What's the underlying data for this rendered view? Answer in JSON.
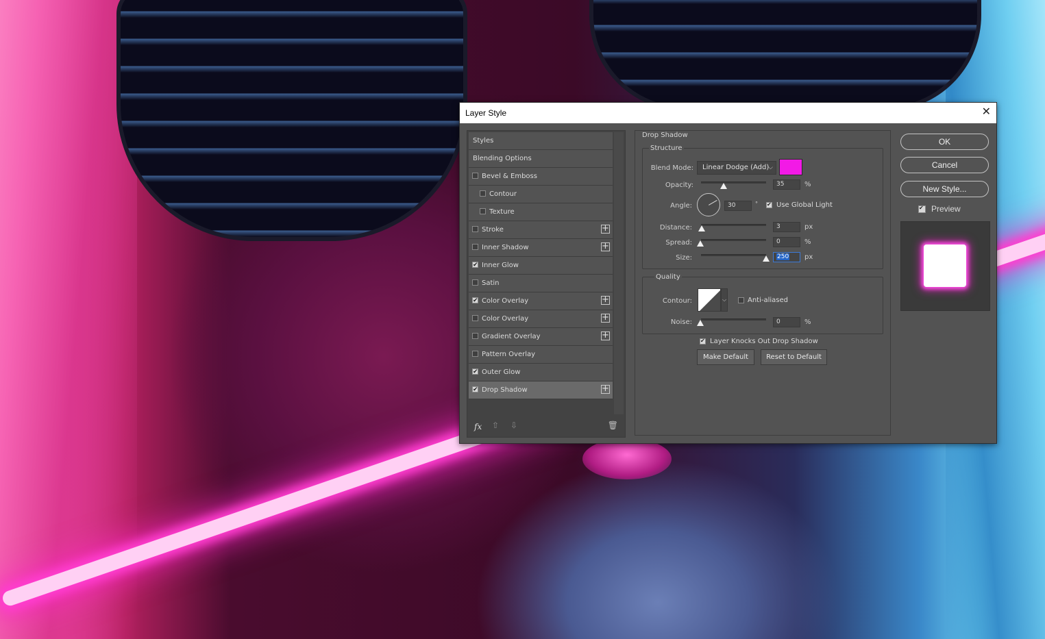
{
  "dialog": {
    "title": "Layer Style",
    "close_glyph": "✕"
  },
  "styles_list": {
    "header": "Styles",
    "blending_options": "Blending Options",
    "items": [
      {
        "label": "Bevel & Emboss",
        "checked": false,
        "has_plus": false,
        "indent": false
      },
      {
        "label": "Contour",
        "checked": false,
        "has_plus": false,
        "indent": true
      },
      {
        "label": "Texture",
        "checked": false,
        "has_plus": false,
        "indent": true
      },
      {
        "label": "Stroke",
        "checked": false,
        "has_plus": true,
        "indent": false
      },
      {
        "label": "Inner Shadow",
        "checked": false,
        "has_plus": true,
        "indent": false
      },
      {
        "label": "Inner Glow",
        "checked": true,
        "has_plus": false,
        "indent": false
      },
      {
        "label": "Satin",
        "checked": false,
        "has_plus": false,
        "indent": false
      },
      {
        "label": "Color Overlay",
        "checked": true,
        "has_plus": true,
        "indent": false
      },
      {
        "label": "Color Overlay",
        "checked": false,
        "has_plus": true,
        "indent": false
      },
      {
        "label": "Gradient Overlay",
        "checked": false,
        "has_plus": true,
        "indent": false
      },
      {
        "label": "Pattern Overlay",
        "checked": false,
        "has_plus": false,
        "indent": false
      },
      {
        "label": "Outer Glow",
        "checked": true,
        "has_plus": false,
        "indent": false
      },
      {
        "label": "Drop Shadow",
        "checked": true,
        "has_plus": true,
        "indent": false,
        "selected": true
      }
    ],
    "fx_label": "fx"
  },
  "drop_shadow": {
    "title": "Drop Shadow",
    "structure_title": "Structure",
    "blend_mode_label": "Blend Mode:",
    "blend_mode_value": "Linear Dodge (Add)",
    "shadow_color": "#f21ae6",
    "opacity_label": "Opacity:",
    "opacity_value": "35",
    "opacity_fraction": 0.35,
    "percent_unit": "%",
    "angle_label": "Angle:",
    "angle_value": "30",
    "degree_unit": "°",
    "use_global_light_label": "Use Global Light",
    "use_global_light": true,
    "distance_label": "Distance:",
    "distance_value": "3",
    "px_unit": "px",
    "spread_label": "Spread:",
    "spread_value": "0",
    "size_label": "Size:",
    "size_value": "250",
    "quality_title": "Quality",
    "contour_label": "Contour:",
    "anti_aliased_label": "Anti-aliased",
    "anti_aliased": false,
    "noise_label": "Noise:",
    "noise_value": "0",
    "knocks_out_label": "Layer Knocks Out Drop Shadow",
    "knocks_out": true,
    "make_default_label": "Make Default",
    "reset_default_label": "Reset to Default"
  },
  "actions": {
    "ok_label": "OK",
    "cancel_label": "Cancel",
    "new_style_label": "New Style...",
    "preview_label": "Preview",
    "preview_checked": true
  }
}
